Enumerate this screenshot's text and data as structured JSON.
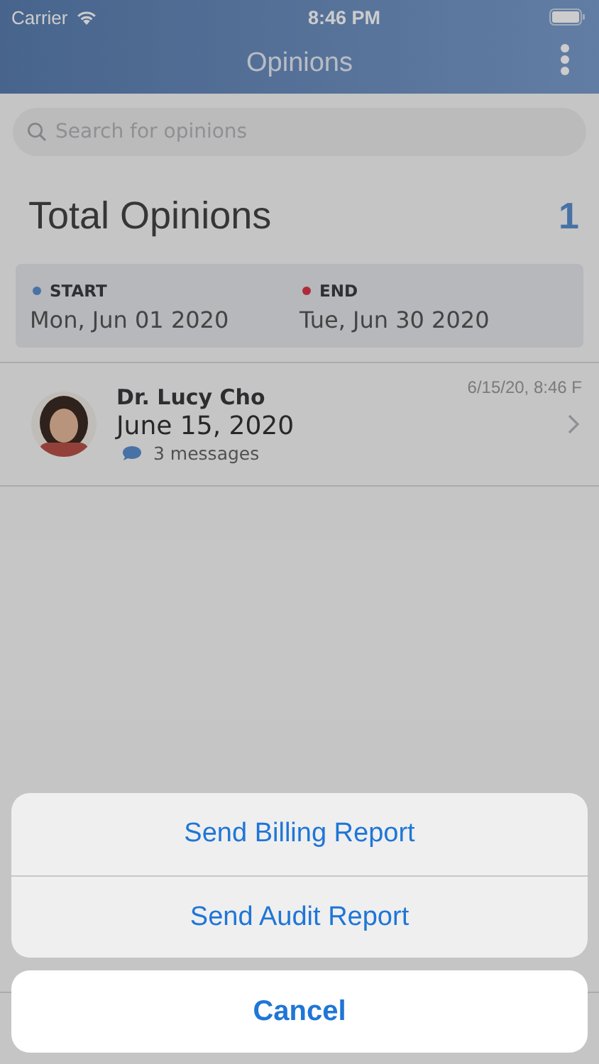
{
  "status_bar": {
    "carrier": "Carrier",
    "time": "8:46 PM"
  },
  "nav_bar": {
    "title": "Opinions"
  },
  "search": {
    "placeholder": "Search for opinions"
  },
  "summary": {
    "label": "Total Opinions",
    "count": "1"
  },
  "date_range": [
    {
      "label": "START",
      "date": "Mon, Jun 01 2020",
      "color": "#4972a6"
    },
    {
      "label": "END",
      "date": "Tue, Jun 30 2020",
      "color": "#ae2b3b"
    }
  ],
  "opinions": [
    {
      "name": "Dr. Lucy Cho",
      "date": "June 15, 2020",
      "timestamp": "6/15/20, 8:46 F",
      "messages": "3 messages"
    }
  ],
  "action_sheet": {
    "actions": [
      "Send Billing Report",
      "Send Audit Report"
    ],
    "cancel": "Cancel"
  }
}
